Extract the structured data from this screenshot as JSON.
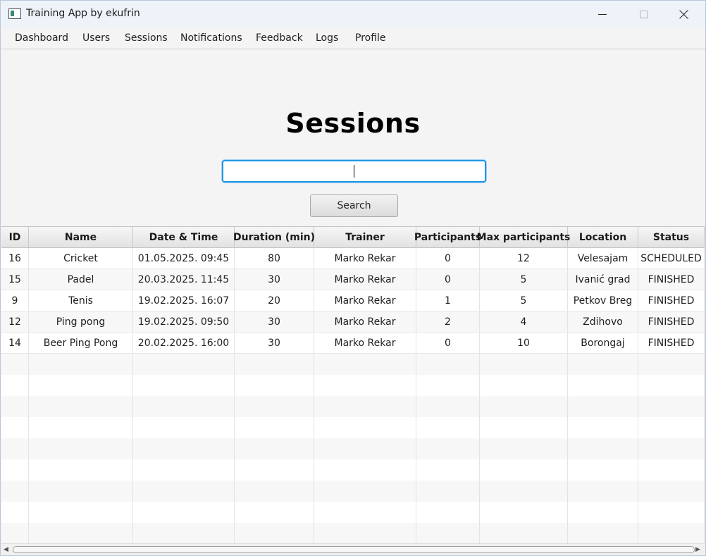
{
  "window": {
    "title": "Training App by ekufrin"
  },
  "menu": [
    {
      "label": "Dashboard"
    },
    {
      "label": "Users"
    },
    {
      "label": "Sessions"
    },
    {
      "label": "Notifications"
    },
    {
      "label": "Feedback"
    },
    {
      "label": "Logs"
    },
    {
      "label": "Profile"
    }
  ],
  "page": {
    "heading": "Sessions",
    "search_value": "",
    "search_button": "Search"
  },
  "table": {
    "columns": [
      "ID",
      "Name",
      "Date & Time",
      "Duration (min)",
      "Trainer",
      "Participants",
      "Max participants",
      "Location",
      "Status"
    ],
    "rows": [
      [
        "16",
        "Cricket",
        "01.05.2025. 09:45",
        "80",
        "Marko Rekar",
        "0",
        "12",
        "Velesajam",
        "SCHEDULED"
      ],
      [
        "15",
        "Padel",
        "20.03.2025. 11:45",
        "30",
        "Marko Rekar",
        "0",
        "5",
        "Ivanić grad",
        "FINISHED"
      ],
      [
        "9",
        "Tenis",
        "19.02.2025. 16:07",
        "20",
        "Marko Rekar",
        "1",
        "5",
        "Petkov Breg",
        "FINISHED"
      ],
      [
        "12",
        "Ping pong",
        "19.02.2025. 09:50",
        "30",
        "Marko Rekar",
        "2",
        "4",
        "Zdihovo",
        "FINISHED"
      ],
      [
        "14",
        "Beer Ping Pong",
        "20.02.2025. 16:00",
        "30",
        "Marko Rekar",
        "0",
        "10",
        "Borongaj",
        "FINISHED"
      ]
    ]
  },
  "colors": {
    "accent": "#2196e3",
    "titlebar": "#eef3fa"
  }
}
